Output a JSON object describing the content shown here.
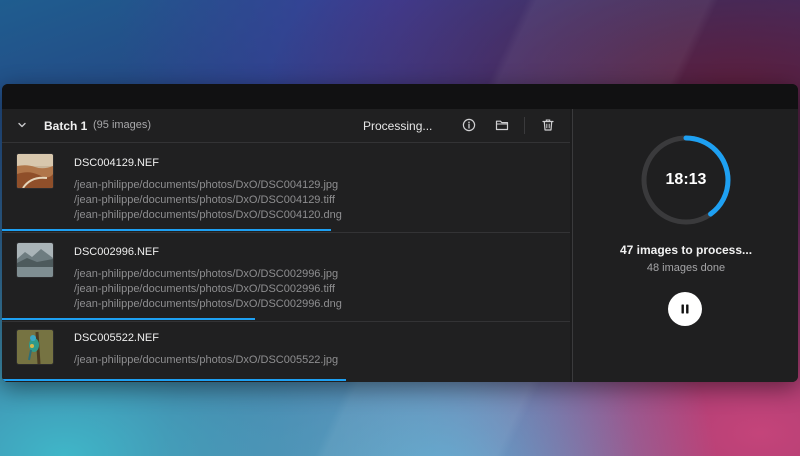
{
  "batch": {
    "title": "Batch 1",
    "count": "(95 images)",
    "status": "Processing...",
    "actions": {
      "info_icon": "info-icon",
      "folder_icon": "folder-icon",
      "delete_icon": "trash-icon"
    }
  },
  "files": [
    {
      "name": "DSC004129.NEF",
      "outputs": [
        "/jean-philippe/documents/photos/DxO/DSC004129.jpg",
        "/jean-philippe/documents/photos/DxO/DSC004129.tiff",
        "/jean-philippe/documents/photos/DxO/DSC004120.dng"
      ],
      "progress": 0.58
    },
    {
      "name": "DSC002996.NEF",
      "outputs": [
        "/jean-philippe/documents/photos/DxO/DSC002996.jpg",
        "/jean-philippe/documents/photos/DxO/DSC002996.tiff",
        "/jean-philippe/documents/photos/DxO/DSC002996.dng"
      ],
      "progress": 0.445
    },
    {
      "name": "DSC005522.NEF",
      "outputs": [
        "/jean-philippe/documents/photos/DxO/DSC005522.jpg"
      ],
      "progress": 0.605
    }
  ],
  "summary": {
    "timer": "18:13",
    "to_process": "47 images to process...",
    "done": "48 images done",
    "ring_progress": 0.4,
    "pause_icon": "pause-icon"
  },
  "colors": {
    "accent": "#1ea0f2",
    "ring_track": "#3a3a3c"
  }
}
